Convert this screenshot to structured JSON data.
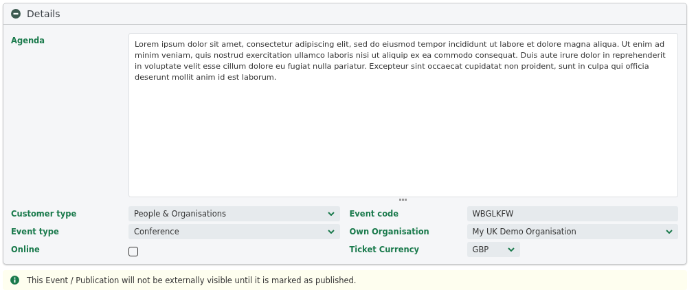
{
  "panel": {
    "title": "Details",
    "expanded": true
  },
  "agenda": {
    "label": "Agenda",
    "value": "Lorem ipsum dolor sit amet, consectetur adipiscing elit, sed do eiusmod tempor incididunt ut labore et dolore magna aliqua. Ut enim ad minim veniam, quis nostrud exercitation ullamco laboris nisi ut aliquip ex ea commodo consequat. Duis aute irure dolor in reprehenderit in voluptate velit esse cillum dolore eu fugiat nulla pariatur. Excepteur sint occaecat cupidatat non proident, sunt in culpa qui officia deserunt mollit anim id est laborum."
  },
  "left_fields": [
    {
      "label": "Customer type",
      "kind": "select",
      "value": "People & Organisations"
    },
    {
      "label": "Event type",
      "kind": "select",
      "value": "Conference"
    },
    {
      "label": "Online",
      "kind": "checkbox",
      "checked": false
    }
  ],
  "right_fields": [
    {
      "label": "Event code",
      "kind": "text",
      "value": "WBGLKFW"
    },
    {
      "label": "Own Organisation",
      "kind": "select",
      "value": "My UK Demo Organisation"
    },
    {
      "label": "Ticket Currency",
      "kind": "select",
      "value": "GBP",
      "compact": true
    }
  ],
  "notice": {
    "text": "This Event / Publication will not be externally visible until it is marked as published."
  }
}
